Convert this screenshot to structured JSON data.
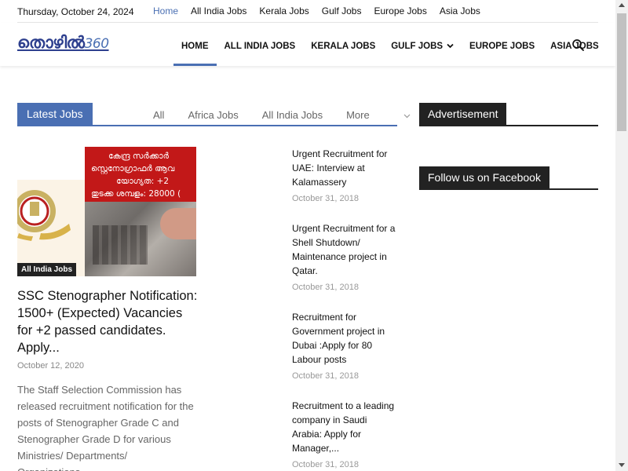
{
  "topbar": {
    "date": "Thursday, October 24, 2024",
    "links": [
      "Home",
      "All India Jobs",
      "Kerala Jobs",
      "Gulf Jobs",
      "Europe Jobs",
      "Asia Jobs"
    ]
  },
  "header": {
    "logo_text": "തൊഴിൽ",
    "logo_num": "360",
    "nav": [
      "HOME",
      "ALL INDIA JOBS",
      "KERALA JOBS",
      "GULF JOBS",
      "EUROPE JOBS",
      "ASIA JOBS"
    ],
    "nav_dropdown_icon": "chevron-down-icon",
    "search_icon": "search-icon"
  },
  "latest": {
    "title": "Latest Jobs",
    "tabs": [
      "All",
      "Africa Jobs",
      "All India Jobs",
      "More"
    ],
    "featured": {
      "category": "All India Jobs",
      "image_lines": [
        "കേന്ദ്ര സർക്കാർ",
        "സ്റ്റെനോഗ്രാഫർ ആവ",
        "യോഗ്യത: +2",
        "തുടക്ക ശമ്പളം: 28000 ("
      ],
      "title": "SSC Stenographer Notification: 1500+ (Expected) Vacancies for +2 passed candidates. Apply...",
      "date": "October 12, 2020",
      "excerpt": "The Staff Selection Commission has released recruitment notification for the posts of Stenographer Grade C and Stenographer Grade D for various Ministries/ Departments/ Organizations..."
    },
    "list": [
      {
        "title": "Urgent Recruitment for UAE: Interview at Kalamassery",
        "date": "October 31, 2018"
      },
      {
        "title": "Urgent Recruitment for a Shell Shutdown/ Maintenance project in Qatar.",
        "date": "October 31, 2018"
      },
      {
        "title": "Recruitment for Government project in Dubai :Apply for 80 Labour posts",
        "date": "October 31, 2018"
      },
      {
        "title": "Recruitment to a leading company in Saudi Arabia: Apply for Manager,...",
        "date": "October 31, 2018"
      }
    ]
  },
  "sidebar": {
    "advertisement": "Advertisement",
    "facebook": "Follow us on Facebook"
  },
  "colors": {
    "accent": "#4a6fb3",
    "dark": "#222222",
    "image_red": "#c21818"
  }
}
